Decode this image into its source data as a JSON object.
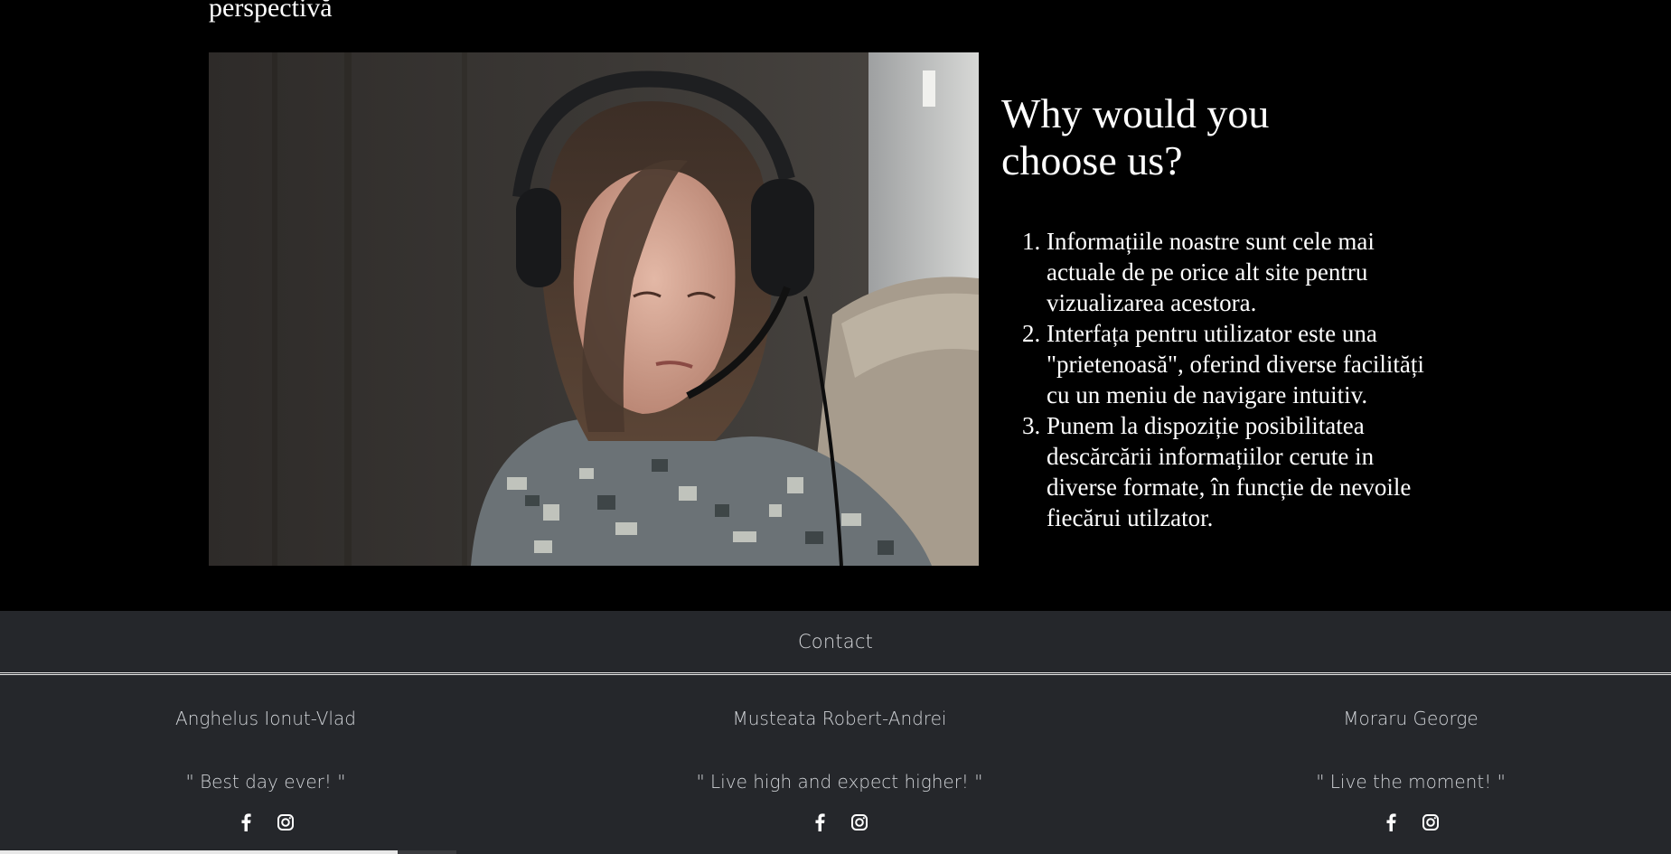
{
  "top": {
    "text": "perspectivă"
  },
  "why": {
    "title": "Why would you choose us?",
    "items": [
      "Informațiile noastre sunt cele mai actuale de pe orice alt site pentru vizualizarea acestora.",
      "Interfața pentru utilizator este una \"prietenoasă\", oferind diverse facilități cu un meniu de navigare intuitiv.",
      "Punem la dispoziție posibilitatea descărcării informațiilor cerute in diverse formate, în funcție de nevoile fiecărui utilzator."
    ]
  },
  "footer": {
    "contact_label": "Contact",
    "members": [
      {
        "name": "Anghelus Ionut-Vlad",
        "quote": "\" Best day ever! \""
      },
      {
        "name": "Musteata Robert-Andrei",
        "quote": "\" Live high and expect higher! \""
      },
      {
        "name": "Moraru George",
        "quote": "\" Live the moment! \""
      }
    ],
    "icons": [
      "facebook-icon",
      "instagram-icon"
    ]
  },
  "colors": {
    "background": "#000000",
    "footer": "#25272b",
    "footer_text": "#d0d3d7"
  }
}
